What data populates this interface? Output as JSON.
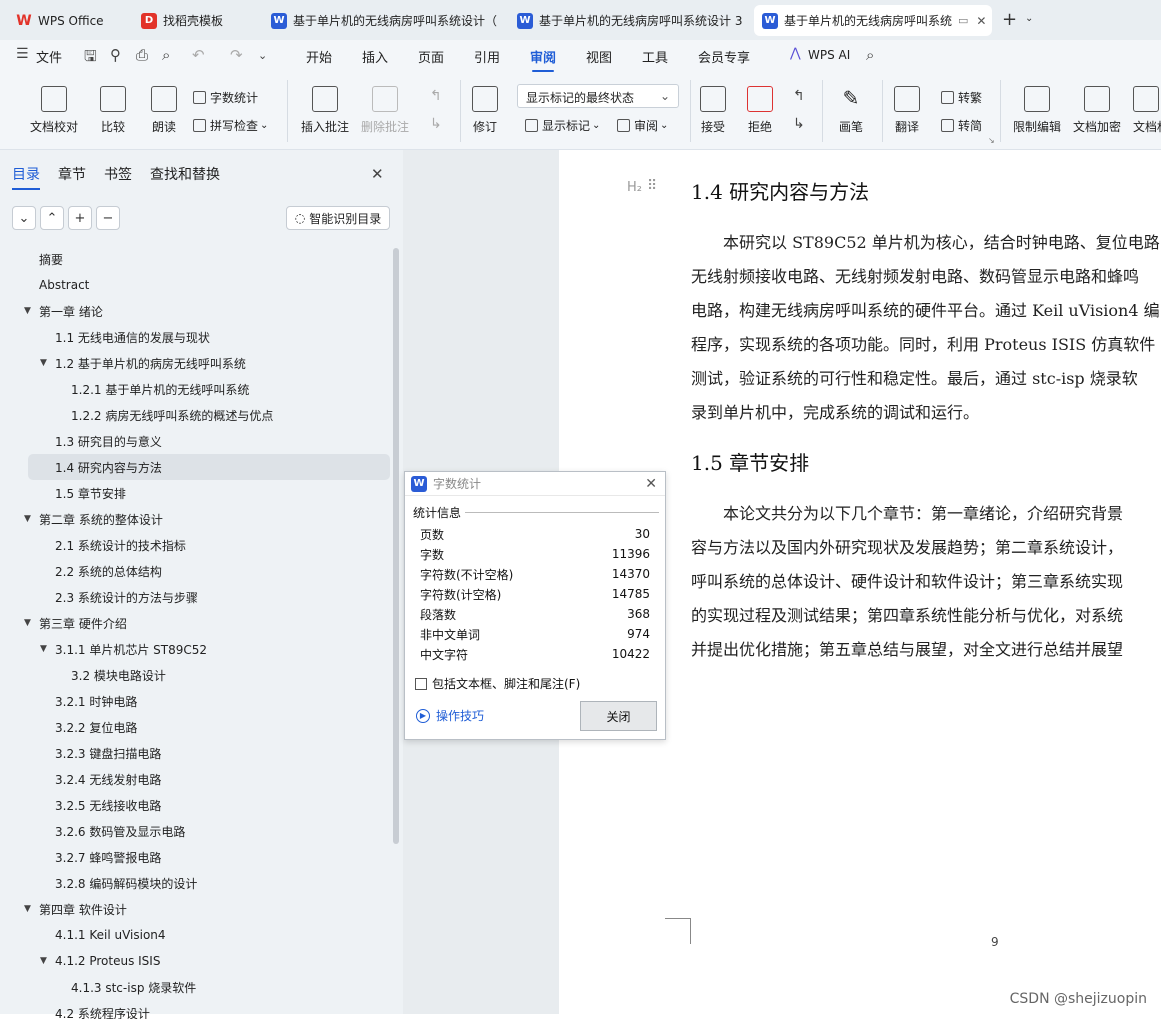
{
  "tabs": [
    {
      "label": "WPS Office",
      "icon": "wps-logo-icon"
    },
    {
      "label": "找稻壳模板",
      "icon": "docer-icon"
    },
    {
      "label": "基于单片机的无线病房呼叫系统设计（",
      "icon": "writer-doc-icon"
    },
    {
      "label": "基于单片机的无线病房呼叫系统设计 3",
      "icon": "writer-doc-icon"
    },
    {
      "label": "基于单片机的无线病房呼叫系统",
      "icon": "writer-doc-icon"
    }
  ],
  "menu": {
    "file": "文件",
    "items": [
      "开始",
      "插入",
      "页面",
      "引用",
      "审阅",
      "视图",
      "工具",
      "会员专享"
    ],
    "active": "审阅",
    "ai": "WPS AI"
  },
  "ribbon": {
    "doc_check": "文档校对",
    "compare": "比较",
    "read_aloud": "朗读",
    "word_count": "字数统计",
    "spell_check": "拼写检查",
    "insert_comment": "插入批注",
    "delete_comment": "删除批注",
    "revise": "修订",
    "markup_dropdown": "显示标记的最终状态",
    "show_markup": "显示标记",
    "review": "审阅",
    "accept": "接受",
    "reject": "拒绝",
    "pen": "画笔",
    "translate": "翻译",
    "to_traditional": "转繁",
    "to_simplified": "转简",
    "restrict_edit": "限制编辑",
    "doc_encrypt": "文档加密",
    "doc_permission": "文档权"
  },
  "left_panel": {
    "tabs": [
      "目录",
      "章节",
      "书签",
      "查找和替换"
    ],
    "active_tab": "目录",
    "smart_toc": "智能识别目录",
    "toc": [
      {
        "label": "摘要",
        "level": 1,
        "expand": false
      },
      {
        "label": "Abstract",
        "level": 1,
        "expand": false
      },
      {
        "label": "第一章  绪论",
        "level": 1,
        "expand": true
      },
      {
        "label": "1.1 无线电通信的发展与现状",
        "level": 2,
        "expand": false
      },
      {
        "label": "1.2 基于单片机的病房无线呼叫系统",
        "level": 2,
        "expand": true
      },
      {
        "label": "1.2.1 基于单片机的无线呼叫系统",
        "level": 3,
        "expand": false
      },
      {
        "label": "1.2.2 病房无线呼叫系统的概述与优点",
        "level": 3,
        "expand": false
      },
      {
        "label": "1.3  研究目的与意义",
        "level": 2,
        "expand": false
      },
      {
        "label": "1.4  研究内容与方法",
        "level": 2,
        "expand": false,
        "selected": true
      },
      {
        "label": "1.5  章节安排",
        "level": 2,
        "expand": false
      },
      {
        "label": "第二章  系统的整体设计",
        "level": 1,
        "expand": true
      },
      {
        "label": "2.1 系统设计的技术指标",
        "level": 2,
        "expand": false
      },
      {
        "label": "2.2 系统的总体结构",
        "level": 2,
        "expand": false
      },
      {
        "label": "2.3 系统设计的方法与步骤",
        "level": 2,
        "expand": false
      },
      {
        "label": "第三章  硬件介绍",
        "level": 1,
        "expand": true
      },
      {
        "label": "3.1.1 单片机芯片 ST89C52",
        "level": 2,
        "expand": true
      },
      {
        "label": "3.2 模块电路设计",
        "level": 3,
        "expand": false
      },
      {
        "label": "3.2.1  时钟电路",
        "level": 2,
        "expand": false
      },
      {
        "label": "3.2.2  复位电路",
        "level": 2,
        "expand": false
      },
      {
        "label": "3.2.3  键盘扫描电路",
        "level": 2,
        "expand": false
      },
      {
        "label": "3.2.4  无线发射电路",
        "level": 2,
        "expand": false
      },
      {
        "label": "3.2.5 无线接收电路",
        "level": 2,
        "expand": false
      },
      {
        "label": "3.2.6 数码管及显示电路",
        "level": 2,
        "expand": false
      },
      {
        "label": "3.2.7 蜂鸣警报电路",
        "level": 2,
        "expand": false
      },
      {
        "label": "3.2.8  编码解码模块的设计",
        "level": 2,
        "expand": false
      },
      {
        "label": "第四章    软件设计",
        "level": 1,
        "expand": true
      },
      {
        "label": "4.1.1 Keil uVision4",
        "level": 2,
        "expand": false
      },
      {
        "label": "4.1.2 Proteus ISIS",
        "level": 2,
        "expand": true
      },
      {
        "label": "4.1.3 stc-isp 烧录软件",
        "level": 3,
        "expand": false
      },
      {
        "label": "4.2  系统程序设计",
        "level": 2,
        "expand": false
      }
    ]
  },
  "document": {
    "heading_marker": "H₂",
    "section1_title": "1.4  研究内容与方法",
    "section1_lines": [
      "本研究以 ST89C52 单片机为核心，结合时钟电路、复位电路",
      "无线射频接收电路、无线射频发射电路、数码管显示电路和蜂鸣",
      "电路，构建无线病房呼叫系统的硬件平台。通过 Keil uVision4 编",
      "程序，实现系统的各项功能。同时，利用 Proteus ISIS 仿真软件",
      "测试，验证系统的可行性和稳定性。最后，通过 stc-isp 烧录软",
      "录到单片机中，完成系统的调试和运行。"
    ],
    "section2_title": "1.5  章节安排",
    "section2_lines": [
      "本论文共分为以下几个章节：第一章绪论，介绍研究背景",
      "容与方法以及国内外研究现状及发展趋势；第二章系统设计，",
      "呼叫系统的总体设计、硬件设计和软件设计；第三章系统实现",
      "的实现过程及测试结果；第四章系统性能分析与优化，对系统",
      "并提出优化措施；第五章总结与展望，对全文进行总结并展望"
    ],
    "page_number": "9",
    "watermark": "CSDN @shejizuopin"
  },
  "dialog": {
    "title": "字数统计",
    "section_label": "统计信息",
    "stats": [
      {
        "label": "页数",
        "value": "30"
      },
      {
        "label": "字数",
        "value": "11396"
      },
      {
        "label": "字符数(不计空格)",
        "value": "14370"
      },
      {
        "label": "字符数(计空格)",
        "value": "14785"
      },
      {
        "label": "段落数",
        "value": "368"
      },
      {
        "label": "非中文单词",
        "value": "974"
      },
      {
        "label": "中文字符",
        "value": "10422"
      }
    ],
    "checkbox_label": "包括文本框、脚注和尾注(F)",
    "checkbox_checked": false,
    "tips_link": "操作技巧",
    "close_button": "关闭"
  },
  "colors": {
    "accent": "#1f5dd6",
    "panel_bg": "#eef2f5",
    "doc_bg": "#e8ecef"
  }
}
